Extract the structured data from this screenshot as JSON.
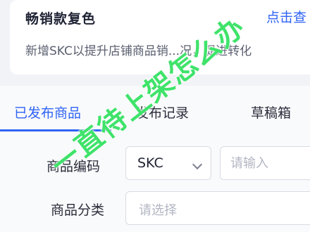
{
  "notice": {
    "title": "畅销款复色",
    "link": "点击查",
    "description": "新增SKC以提升店铺商品销...况，促进转化"
  },
  "tabs": [
    {
      "label": "已发布商品",
      "active": true
    },
    {
      "label": "发布记录",
      "active": false
    },
    {
      "label": "草稿箱",
      "active": false
    }
  ],
  "filters": {
    "code_label": "商品编码",
    "code_type": "SKC",
    "code_placeholder": "请输入",
    "category_label": "商品分类",
    "category_placeholder": "请选择"
  },
  "watermark": "一直待上架怎么办",
  "colors": {
    "accent": "#2f63f5",
    "watermark": "#3fe36a"
  }
}
